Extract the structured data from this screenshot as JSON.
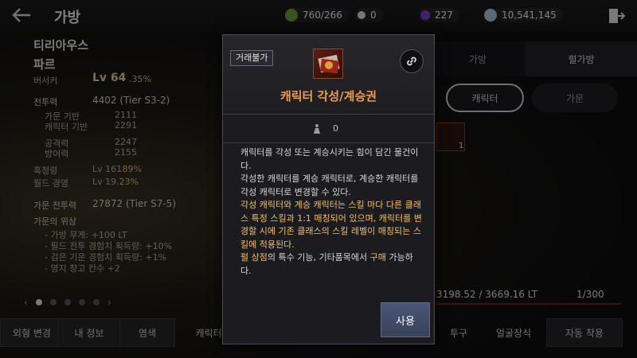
{
  "header": {
    "title": "가방",
    "currencies": [
      {
        "name": "energy",
        "value": "760/266",
        "color": "#7ab84a"
      },
      {
        "name": "pearl",
        "value": "0",
        "color": "#d8d8d8"
      },
      {
        "name": "purple-gem",
        "value": "227",
        "color": "#8a4ad8"
      },
      {
        "name": "silver",
        "value": "10,541,145",
        "color": "#c8d8e8"
      }
    ]
  },
  "character": {
    "family": "티리아우스",
    "name": "파르",
    "class": "버서커",
    "level": "Lv 64",
    "level_pct": ".35%",
    "combat_label": "전투력",
    "combat_value": "4402 (Tier S3-2)",
    "family_base_label": "가문 기반",
    "family_base_value": "2111",
    "char_base_label": "캐릭터 기반",
    "char_base_value": "2291",
    "attack_label": "공격력",
    "attack_value": "2247",
    "defense_label": "방어력",
    "defense_value": "2155",
    "black_spirit_label": "흑정령",
    "black_spirit_value": "Lv 161",
    "black_spirit_pct": ".89%",
    "world_label": "월드 경영",
    "world_value": "Lv 19",
    "world_pct": ".23%",
    "family_combat_label": "가문 전투력",
    "family_combat_value": "27872 (Tier S7-5)",
    "prestige_label": "가문의 위상",
    "prestige_lines": [
      "- 가방 무게: +100 LT",
      "- 필드 전투 경험치 획득량: +10%",
      "- 검은 기운 경험치 획득량: +1%",
      "- 영지 창고 칸수 +2"
    ]
  },
  "right_panel": {
    "tab_bag": "가방",
    "tab_pearl_bag": "펄가방",
    "sub_character": "캐릭터",
    "sub_family": "가문",
    "slot_count": "1",
    "weight": "3198.52 / 3669.16 LT",
    "capacity": "1/300"
  },
  "bottom": {
    "appearance_change": "외형 변경",
    "my_info": "내 정보",
    "dye": "염색",
    "character_gear": "캐릭터 외형",
    "helmet": "투구",
    "face_accessory": "얼굴장식",
    "auto_equip": "자동 착용"
  },
  "modal": {
    "badge": "거래불가",
    "title": "캐릭터 각성/계승권",
    "weight": "0",
    "desc_1": "캐릭터를 각성 또는 계승시키는 힘이 담긴 물건이다.",
    "desc_2": "각성한 캐릭터를 계승 캐릭터로, 계승한 캐릭터를 각성 캐릭터로 변경할 수 있다.",
    "desc_3": "각성 캐릭터와 계승 캐릭터는 스킬 마다 다른 클래스 특정 스킬과 1:1 매칭되어 있으며, 캐릭터를 변경할 시에 기존 클래스의 스킬 레벨이 매칭되는 스킬에 적용된다.",
    "desc_4a": "펄 상점",
    "desc_4b": "의 특수 기능, 기타품목에서 ",
    "desc_4c": "구매",
    "desc_4d": " 가능하다.",
    "use_button": "사용"
  }
}
